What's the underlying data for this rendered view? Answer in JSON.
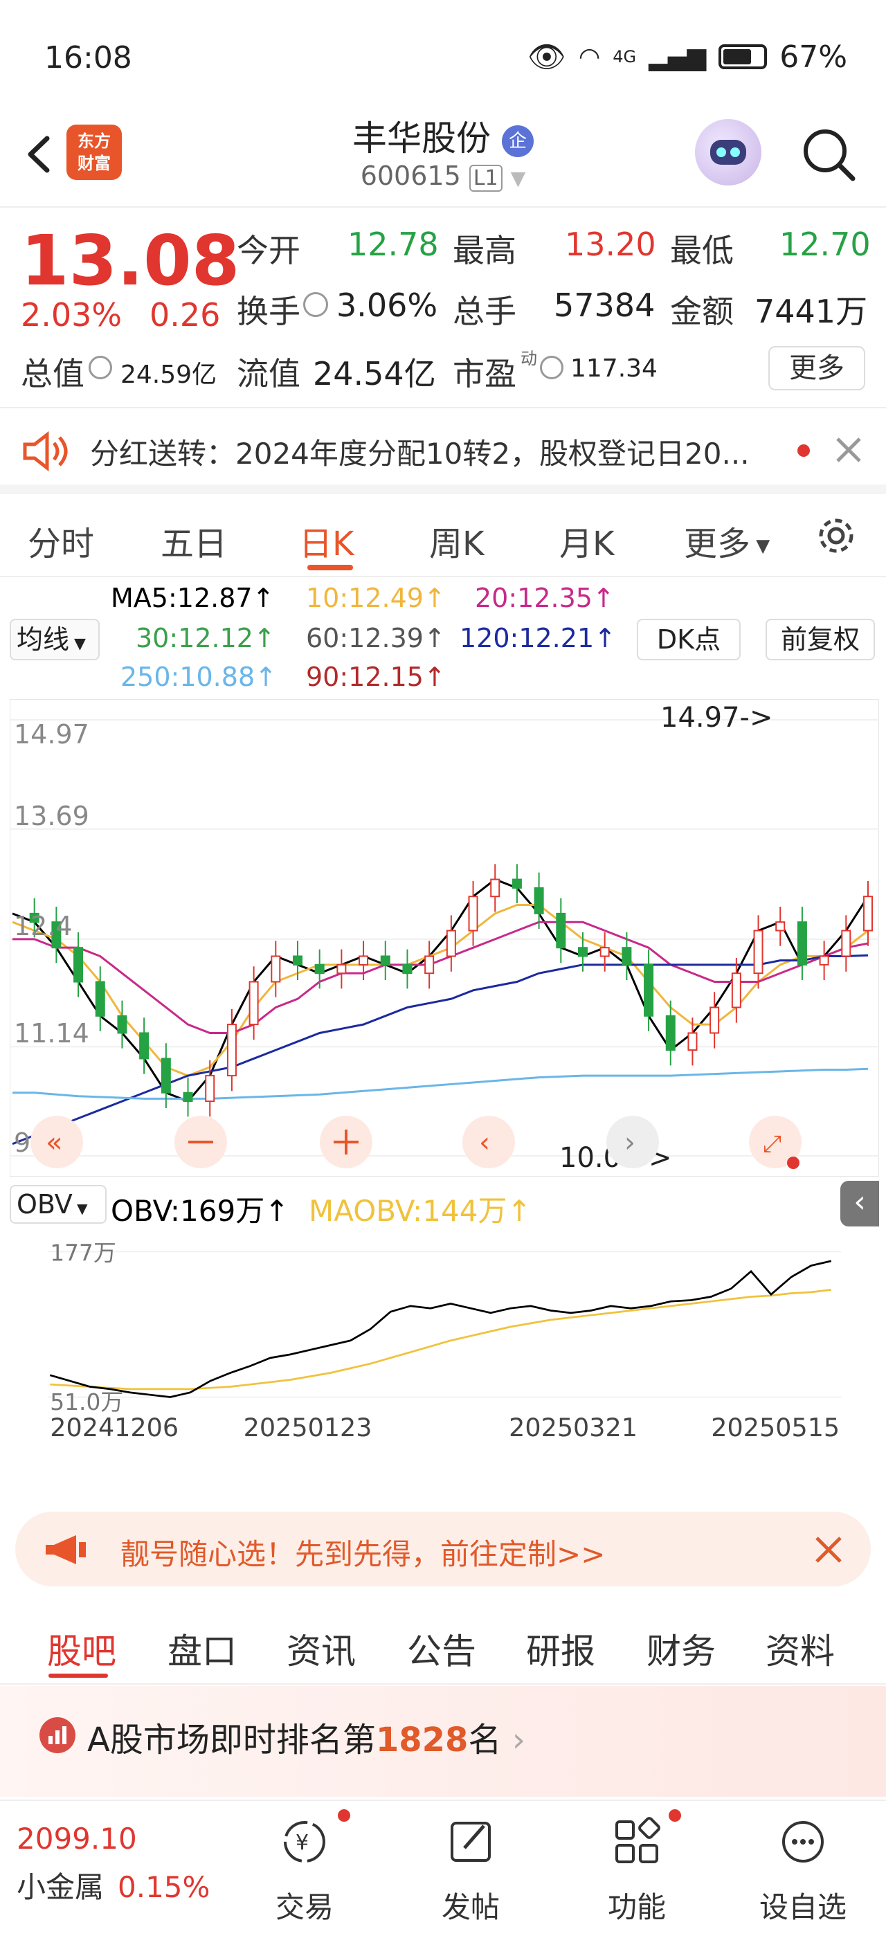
{
  "status": {
    "time": "16:08",
    "network": "4G",
    "battery": "67%"
  },
  "header": {
    "brand_logo": "东方\n财富",
    "stock_name": "丰华股份",
    "badge": "企",
    "stock_code": "600615",
    "level": "L1"
  },
  "quote": {
    "price": "13.08",
    "change_pct": "2.03%",
    "change_abs": "0.26",
    "open_label": "今开",
    "open": "12.78",
    "high_label": "最高",
    "high": "13.20",
    "low_label": "最低",
    "low": "12.70",
    "turnover_label": "换手",
    "turnover": "3.06%",
    "volume_label": "总手",
    "volume": "57384",
    "amount_label": "金额",
    "amount": "7441万",
    "mktcap_label": "总值",
    "mktcap": "24.59亿",
    "float_label": "流值",
    "float_cap": "24.54亿",
    "pe_label": "市盈",
    "pe_sup": "动",
    "pe": "117.34",
    "more": "更多"
  },
  "notice": {
    "text": "分红送转：2024年度分配10转2，股权登记日20..."
  },
  "chart_tabs": [
    "分时",
    "五日",
    "日K",
    "周K",
    "月K",
    "更多"
  ],
  "ma_legend": {
    "dropdown": "均线",
    "ma5": "MA5:12.87↑",
    "ma10": "10:12.49↑",
    "ma20": "20:12.35↑",
    "ma30": "30:12.12↑",
    "ma60": "60:12.39↑",
    "ma120": "120:12.21↑",
    "ma250": "250:10.88↑",
    "ma90": "90:12.15↑",
    "dk": "DK点",
    "adjust": "前复权"
  },
  "colors": {
    "up": "#e0362f",
    "down": "#25a244",
    "ma5": "#000000",
    "ma10": "#f0b63c",
    "ma20": "#c8298a",
    "ma30": "#3aa04a",
    "ma60": "#555555",
    "ma120": "#1c2a9e",
    "ma250": "#6ab6e8",
    "ma90": "#b22a2a"
  },
  "chart_data": {
    "type": "line",
    "title": "",
    "y_ticks": [
      "14.97",
      "13.69",
      "12.4",
      "11.14",
      "9.86"
    ],
    "ylim": [
      9.86,
      14.97
    ],
    "max_label": "14.97->",
    "min_label": "10.00->",
    "x_ticks": [
      "20241206",
      "20250123",
      "20250321",
      "20250515"
    ],
    "series": [
      {
        "name": "MA5",
        "values": [
          12.7,
          12.6,
          12.3,
          11.9,
          11.5,
          11.3,
          11.0,
          10.6,
          10.5,
          10.8,
          11.4,
          11.9,
          12.2,
          12.1,
          12.0,
          12.1,
          12.2,
          12.1,
          12.0,
          12.2,
          12.5,
          12.9,
          13.1,
          13.0,
          12.7,
          12.3,
          12.2,
          12.3,
          12.1,
          11.5,
          11.1,
          11.3,
          11.6,
          12.0,
          12.5,
          12.6,
          12.1,
          12.2,
          12.5,
          12.9
        ]
      },
      {
        "name": "MA10",
        "values": [
          12.6,
          12.5,
          12.4,
          12.2,
          11.9,
          11.5,
          11.2,
          10.9,
          10.8,
          10.9,
          11.2,
          11.6,
          11.9,
          12.0,
          12.1,
          12.1,
          12.1,
          12.1,
          12.1,
          12.2,
          12.3,
          12.5,
          12.7,
          12.8,
          12.8,
          12.6,
          12.4,
          12.3,
          12.2,
          11.9,
          11.6,
          11.4,
          11.4,
          11.6,
          11.9,
          12.1,
          12.2,
          12.2,
          12.3,
          12.5
        ]
      },
      {
        "name": "MA20",
        "values": [
          12.4,
          12.4,
          12.3,
          12.3,
          12.2,
          12.0,
          11.8,
          11.6,
          11.4,
          11.3,
          11.3,
          11.4,
          11.6,
          11.7,
          11.9,
          12.0,
          12.0,
          12.1,
          12.1,
          12.1,
          12.2,
          12.3,
          12.4,
          12.5,
          12.6,
          12.6,
          12.6,
          12.5,
          12.4,
          12.3,
          12.1,
          12.0,
          11.9,
          11.9,
          11.9,
          12.0,
          12.1,
          12.2,
          12.3,
          12.35
        ]
      },
      {
        "name": "MA120",
        "values": [
          10.0,
          10.1,
          10.2,
          10.3,
          10.4,
          10.5,
          10.6,
          10.7,
          10.8,
          10.85,
          10.9,
          11.0,
          11.1,
          11.2,
          11.3,
          11.35,
          11.4,
          11.5,
          11.6,
          11.65,
          11.7,
          11.8,
          11.85,
          11.9,
          12.0,
          12.05,
          12.1,
          12.1,
          12.1,
          12.1,
          12.1,
          12.1,
          12.1,
          12.1,
          12.1,
          12.15,
          12.15,
          12.2,
          12.2,
          12.21
        ]
      },
      {
        "name": "MA250",
        "values": [
          10.6,
          10.6,
          10.58,
          10.56,
          10.55,
          10.54,
          10.53,
          10.53,
          10.53,
          10.53,
          10.54,
          10.55,
          10.56,
          10.57,
          10.58,
          10.6,
          10.62,
          10.64,
          10.66,
          10.68,
          10.7,
          10.72,
          10.74,
          10.76,
          10.78,
          10.79,
          10.8,
          10.8,
          10.8,
          10.8,
          10.8,
          10.81,
          10.82,
          10.83,
          10.84,
          10.85,
          10.86,
          10.87,
          10.87,
          10.88
        ]
      }
    ],
    "obv": {
      "label": "OBV:169万↑",
      "ma_label": "MAOBV:144万↑",
      "dropdown": "OBV",
      "y_ticks": [
        "177万",
        "51.0万"
      ],
      "ylim": [
        51,
        177
      ],
      "obv_values": [
        70,
        65,
        60,
        58,
        55,
        53,
        51,
        55,
        65,
        72,
        78,
        85,
        88,
        92,
        96,
        100,
        110,
        125,
        130,
        128,
        132,
        128,
        124,
        128,
        130,
        126,
        124,
        126,
        130,
        128,
        130,
        134,
        135,
        138,
        145,
        160,
        140,
        155,
        165,
        169
      ],
      "maobv_values": [
        62,
        61,
        60,
        59,
        58,
        58,
        58,
        58,
        59,
        60,
        62,
        64,
        66,
        69,
        72,
        76,
        80,
        85,
        90,
        95,
        100,
        104,
        108,
        112,
        115,
        118,
        120,
        122,
        124,
        126,
        128,
        130,
        132,
        134,
        136,
        138,
        139,
        141,
        142,
        144
      ]
    }
  },
  "banner": {
    "text": "靓号随心选！先到先得，前往定制>>"
  },
  "bottom_tabs": [
    "股吧",
    "盘口",
    "资讯",
    "公告",
    "研报",
    "财务",
    "资料"
  ],
  "rank": {
    "prefix": "A股市场即时排名第",
    "rank": "1828",
    "suffix": "名"
  },
  "bottom_nav": {
    "index_value": "2099.10",
    "index_name": "小金属",
    "index_change": "0.15%",
    "items": [
      "交易",
      "发帖",
      "功能",
      "设自选"
    ]
  }
}
